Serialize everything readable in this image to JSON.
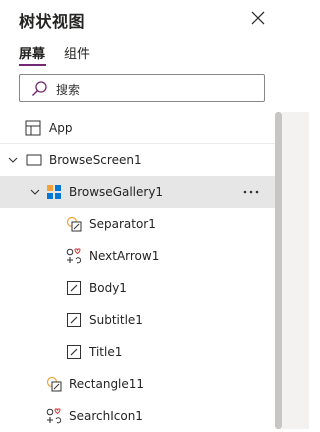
{
  "panel": {
    "title": "树状视图",
    "close_icon": "close-icon"
  },
  "tabs": [
    {
      "label": "屏幕",
      "active": true
    },
    {
      "label": "组件",
      "active": false
    }
  ],
  "search": {
    "placeholder": "搜索",
    "icon": "search-icon"
  },
  "tree": {
    "items": [
      {
        "label": "App",
        "icon": "app-icon",
        "depth": 0
      },
      {
        "label": "BrowseScreen1",
        "icon": "screen-icon",
        "depth": 0,
        "expanded": true
      },
      {
        "label": "BrowseGallery1",
        "icon": "gallery-icon",
        "depth": 1,
        "expanded": true,
        "selected": true,
        "more": "…"
      },
      {
        "label": "Separator1",
        "icon": "shape-icon",
        "depth": 2
      },
      {
        "label": "NextArrow1",
        "icon": "icon-control-icon",
        "depth": 2
      },
      {
        "label": "Body1",
        "icon": "label-icon",
        "depth": 2
      },
      {
        "label": "Subtitle1",
        "icon": "label-icon",
        "depth": 2
      },
      {
        "label": "Title1",
        "icon": "label-icon",
        "depth": 2
      },
      {
        "label": "Rectangle11",
        "icon": "shape-icon",
        "depth": 1
      },
      {
        "label": "SearchIcon1",
        "icon": "icon-control-icon",
        "depth": 1
      }
    ]
  },
  "colors": {
    "accent": "#742774",
    "selected_bg": "#e6e6e6",
    "gallery_blue": "#0078d4",
    "gallery_orange": "#f2a23a",
    "icon_red": "#d13438"
  }
}
